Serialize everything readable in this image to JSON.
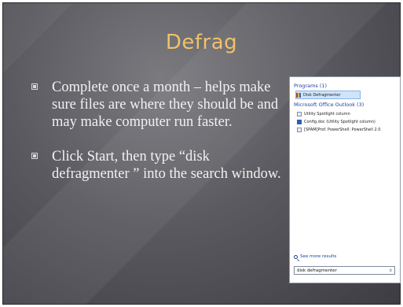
{
  "slide": {
    "title": "Defrag",
    "bullets": [
      "Complete once a month – helps make sure files are where they should be and may make computer run faster.",
      "Click Start, then type “disk defragmenter ” into the search window."
    ]
  },
  "start_menu": {
    "sections": [
      {
        "heading": "Programs (1)",
        "items": [
          {
            "label": "Disk Defragmenter",
            "icon": "defrag-icon",
            "selected": true
          }
        ]
      },
      {
        "heading": "Microsoft Office Outlook (3)",
        "items": [
          {
            "label": "Utility Spotlight column",
            "icon": "mail-icon"
          },
          {
            "label": "Config.doc (Utility Spotlight column)",
            "icon": "doc-icon"
          },
          {
            "label": "[SPAM]Prof. PowerShell: PowerShell 2.0",
            "icon": "mail-icon"
          }
        ]
      }
    ],
    "see_more": "See more results",
    "search_value": "disk defragmenter",
    "clear_label": "x"
  },
  "colors": {
    "title": "#f0c168",
    "body_text": "#f2f2f2",
    "background_dark": "#3c3c42",
    "background_light": "#7a7a7f",
    "link_blue": "#1e3f9a"
  }
}
